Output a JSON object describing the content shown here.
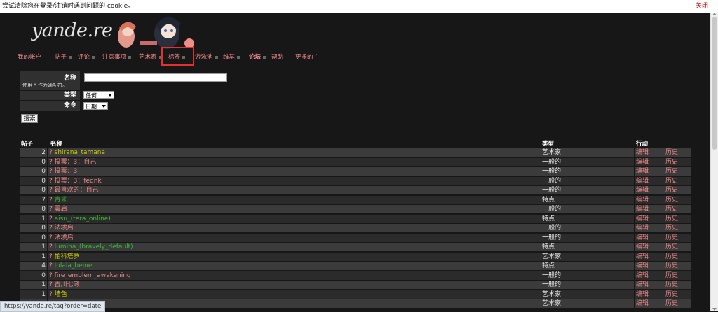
{
  "cookie_bar": {
    "message": "尝试清除您在登录/注销时遇到问题的 cookie。",
    "close_label": "关闭"
  },
  "logo": {
    "text": "yande.re"
  },
  "nav": {
    "items": [
      {
        "label": "我的帐户",
        "has_dot": false
      },
      {
        "label": "帖子",
        "has_dot": true
      },
      {
        "label": "评论",
        "has_dot": true
      },
      {
        "label": "注意事项",
        "has_dot": true
      },
      {
        "label": "艺术家",
        "has_dot": true
      },
      {
        "label": "标签",
        "has_dot": true,
        "active": true
      },
      {
        "label": "游泳池",
        "has_dot": true
      },
      {
        "label": "维基",
        "has_dot": true
      },
      {
        "label": "论坛",
        "has_dot": true
      },
      {
        "label": "帮助",
        "has_dot": false
      },
      {
        "label": "更多的 ″",
        "has_dot": false
      }
    ]
  },
  "search": {
    "name_label": "名称",
    "name_hint": "使用 * 作为通配符。",
    "name_value": "",
    "type_label": "类型",
    "type_selected": "任何",
    "order_label": "命令",
    "order_selected": "日期",
    "button_label": "搜索"
  },
  "table": {
    "headers": {
      "count": "帖子",
      "name": "名称",
      "type": "类型",
      "action": "行动"
    },
    "edit_label": "编辑",
    "history_label": "历史",
    "rows": [
      {
        "count": "2",
        "q": "?",
        "name": "shirana_tamana",
        "type": "艺术家",
        "color": "#c9c900"
      },
      {
        "count": "0",
        "q": "?",
        "name": "投票：3：自己",
        "type": "一般的",
        "color": "#ee8887"
      },
      {
        "count": "0",
        "q": "?",
        "name": "投票：3",
        "type": "一般的",
        "color": "#ee8887"
      },
      {
        "count": "0",
        "q": "?",
        "name": "投票：3：fednk",
        "type": "一般的",
        "color": "#ee8887"
      },
      {
        "count": "0",
        "q": "?",
        "name": "最喜欢的：自己",
        "type": "一般的",
        "color": "#ee8887"
      },
      {
        "count": "7",
        "q": "?",
        "name": "青米",
        "type": "特点",
        "color": "#36b836"
      },
      {
        "count": "0",
        "q": "?",
        "name": "震启",
        "type": "一般的",
        "color": "#ee8887"
      },
      {
        "count": "1",
        "q": "?",
        "name": "aisu_(tera_online)",
        "type": "特点",
        "color": "#36b836"
      },
      {
        "count": "0",
        "q": "?",
        "name": "法埃启",
        "type": "一般的",
        "color": "#ee8887"
      },
      {
        "count": "0",
        "q": "?",
        "name": "法埃启",
        "type": "一般的",
        "color": "#ee8887"
      },
      {
        "count": "1",
        "q": "?",
        "name": "lumina_(bravely_default)",
        "type": "特点",
        "color": "#36b836"
      },
      {
        "count": "1",
        "q": "?",
        "name": "帕科塔罗",
        "type": "艺术家",
        "color": "#c9c900"
      },
      {
        "count": "4",
        "q": "?",
        "name": "lulala_heine",
        "type": "特点",
        "color": "#36b836"
      },
      {
        "count": "0",
        "q": "?",
        "name": "fire_emblem_awakening",
        "type": "一般的",
        "color": "#ee8887"
      },
      {
        "count": "1",
        "q": "?",
        "name": "古川七濑",
        "type": "一般的",
        "color": "#ee8887"
      },
      {
        "count": "1",
        "q": "?",
        "name": "墙色",
        "type": "艺术家",
        "color": "#c9c900"
      },
      {
        "count": "",
        "q": "",
        "name": "",
        "type": "艺术家",
        "color": "#c9c900"
      }
    ]
  },
  "status_bar": {
    "url": "https://yande.re/tag?order=date"
  },
  "colors": {
    "link": "#ee8887",
    "artist": "#c9c900",
    "character": "#36b836",
    "row_dark": "#2b2b2b",
    "row_light": "#3b3b3b"
  }
}
